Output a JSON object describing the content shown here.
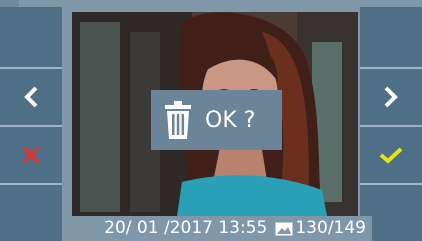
{
  "screen": {
    "delete_prompt": "OK ?",
    "date_time": "20/ 01 /2017 13:55",
    "image_index": "130",
    "image_total": "/149"
  },
  "icons": {
    "left_top": "blank",
    "left_prev": "chevron-left-icon",
    "left_cancel": "close-icon",
    "right_top": "blank",
    "right_next": "chevron-right-icon",
    "right_confirm": "check-icon",
    "dialog": "trash-icon",
    "counter": "photo-icon"
  },
  "colors": {
    "button_bg": "#4e6f86",
    "frame_bg": "#7f97a9",
    "cancel": "#e0322e",
    "confirm": "#e6e21a",
    "dialog_bg": "#6c8497"
  }
}
